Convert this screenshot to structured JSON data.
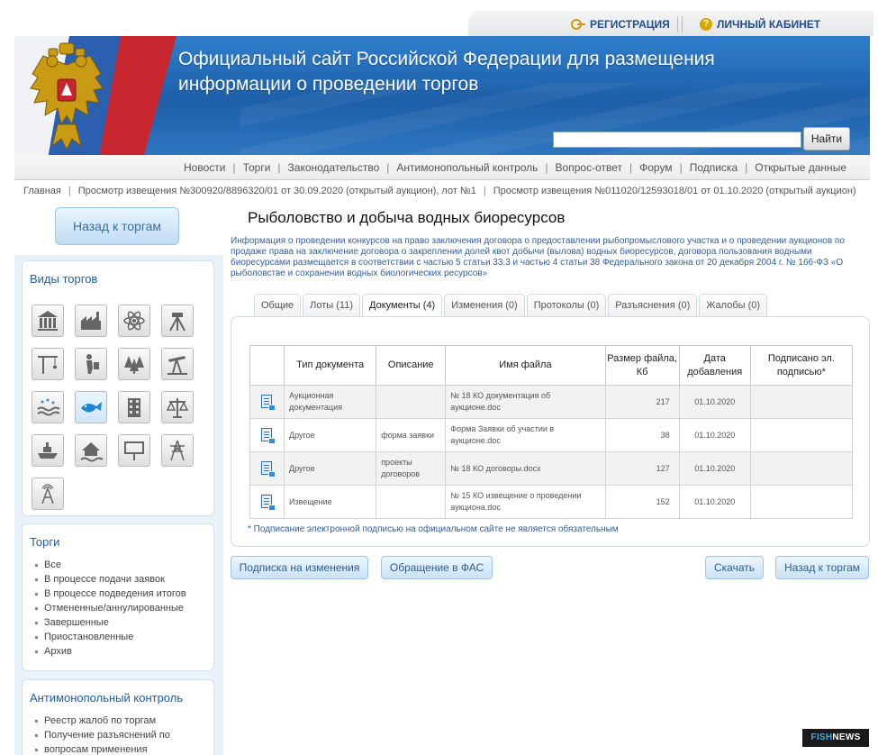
{
  "userbar": {
    "register": "РЕГИСТРАЦИЯ",
    "cabinet": "ЛИЧНЫЙ КАБИНЕТ"
  },
  "header": {
    "title_line1": "Официальный сайт Российской Федерации для размещения",
    "title_line2": "информации о проведении торгов",
    "search_value": "",
    "search_button": "Найти"
  },
  "topnav": [
    "Новости",
    "Торги",
    "Законодательство",
    "Антимонопольный контроль",
    "Вопрос-ответ",
    "Форум",
    "Подписка",
    "Открытые данные"
  ],
  "breadcrumb": [
    "Главная",
    "Просмотр извещения №300920/8896320/01 от 30.09.2020 (открытый аукцион), лот №1",
    "Просмотр извещения №011020/12593018/01 от 01.10.2020 (открытый аукцион)"
  ],
  "left": {
    "back_button": "Назад к торгам",
    "types_title": "Виды торгов",
    "type_icons": [
      "museum-icon",
      "factory-icon",
      "atom-icon",
      "surveyor-icon",
      "crane-icon",
      "worker-icon",
      "forest-icon",
      "oil-pump-icon",
      "water-icon",
      "fish-icon",
      "building-icon",
      "scales-icon",
      "ship-icon",
      "house-flood-icon",
      "billboard-icon",
      "power-tower-icon",
      "radio-tower-icon"
    ],
    "torgi_title": "Торги",
    "torgi_items": [
      "Все",
      "В процессе подачи заявок",
      "В процессе подведения итогов",
      "Отмененные/аннулированные",
      "Завершенные",
      "Приостановленные",
      "Архив"
    ],
    "antimonopoly_title": "Антимонопольный контроль",
    "antimonopoly_items": [
      "Реестр жалоб по торгам",
      "Получение разъяснений по",
      "вопросам применения"
    ]
  },
  "main": {
    "title": "Рыболовство и добыча водных биоресурсов",
    "intro": "Информация о проведении конкурсов на право заключения договора о предоставлении рыбопромыслового участка и о проведении аукционов по продаже права на заключение договора о закреплении долей квот добычи (вылова) водных биоресурсов, договора пользования водными биоресурсами размещается в соответствии с частью 5 статьи 33.3 и частью 4 статьи 38 Федерального закона от 20 декабря 2004 г. № 166-ФЗ «О рыболовстве и сохранении водных биологических ресурсов»",
    "tabs": [
      "Общие",
      "Лоты (11)",
      "Документы (4)",
      "Изменения (0)",
      "Протоколы (0)",
      "Разъяснения (0)",
      "Жалобы (0)"
    ],
    "active_tab": "Документы (4)",
    "table": {
      "headers": [
        "",
        "Тип документа",
        "Описание",
        "Имя файла",
        "Размер файла, Кб",
        "Дата добавления",
        "Подписано эл. подписью*"
      ],
      "rows": [
        {
          "type": "Аукционная документация",
          "desc": "",
          "file": "№ 18 КО документация об аукционе.doc",
          "size": "217",
          "date": "01.10.2020",
          "signed": ""
        },
        {
          "type": "Другое",
          "desc": "форма заявки",
          "file": "Форма Заявки об участии в аукционе.doc",
          "size": "38",
          "date": "01.10.2020",
          "signed": ""
        },
        {
          "type": "Другое",
          "desc": "проекты договоров",
          "file": "№ 18 КО договоры.docx",
          "size": "127",
          "date": "01.10.2020",
          "signed": ""
        },
        {
          "type": "Извещение",
          "desc": "",
          "file": "№ 15 КО извещение о проведении аукциона.doc",
          "size": "152",
          "date": "01.10.2020",
          "signed": ""
        }
      ]
    },
    "footnote": "* Подписание электронной подписью на официальном сайте не является обязательным",
    "buttons": {
      "subscribe": "Подписка на изменения",
      "fas": "Обращение в ФАС",
      "download": "Скачать",
      "back": "Назад к торгам"
    }
  },
  "watermark": {
    "fish": "FISH",
    "news": "NEWS"
  },
  "colors": {
    "banner_blue": "#1d5fa8",
    "link_blue": "#1f5fa3",
    "button_bg": "#c9e2f5"
  }
}
